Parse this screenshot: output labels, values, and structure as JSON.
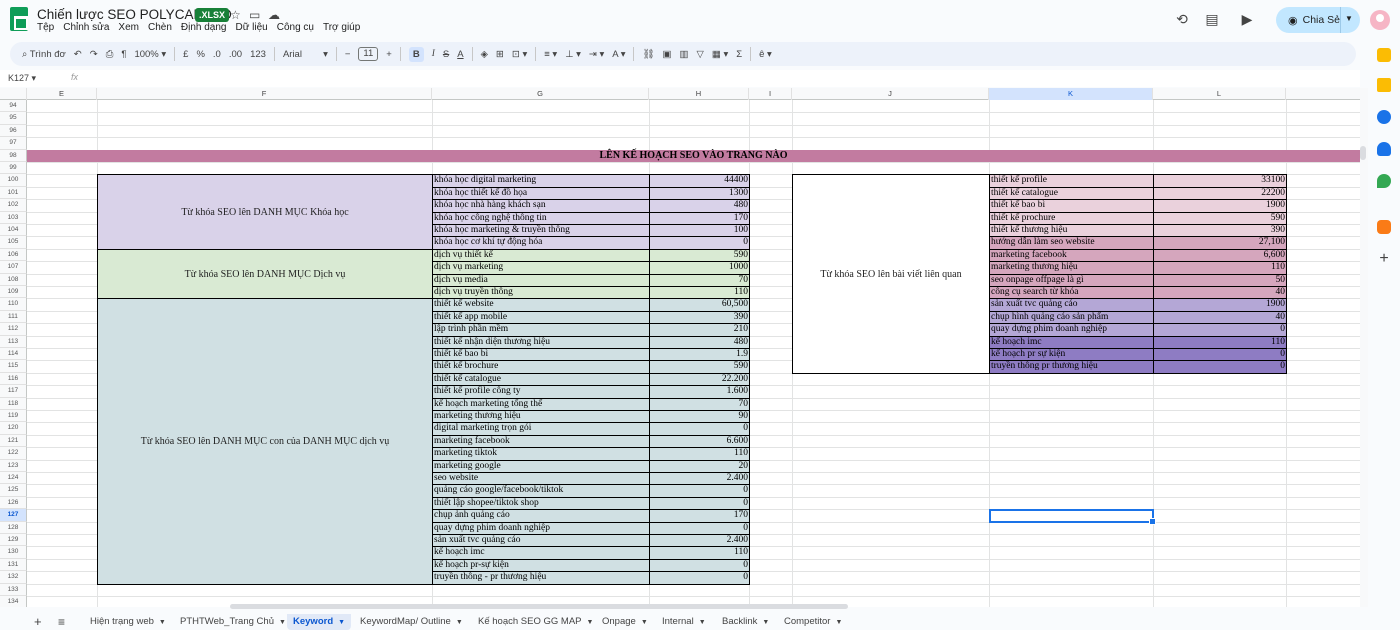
{
  "app": {
    "doc_title": "Chiến lược SEO POLYCANTHO",
    "file_badge": ".XLSX",
    "menus": [
      "Tệp",
      "Chỉnh sửa",
      "Xem",
      "Chèn",
      "Định dạng",
      "Dữ liệu",
      "Công cụ",
      "Trợ giúp"
    ],
    "share_label": "Chia Sẻ"
  },
  "toolbar": {
    "search_label": "Trình đơ",
    "zoom": "100%",
    "currency": "£",
    "percent": "%",
    "dec_less": ".0",
    "dec_more": ".00",
    "numfmt": "123",
    "font": "Arial",
    "font_size": "11"
  },
  "formula_bar": {
    "name_box": "K127",
    "fx": "fx"
  },
  "columns": [
    "E",
    "F",
    "G",
    "H",
    "I",
    "J",
    "K",
    "L"
  ],
  "selected_column": "K",
  "selected_row": "127",
  "rows": [
    "94",
    "95",
    "96",
    "97",
    "98",
    "99",
    "100",
    "101",
    "102",
    "103",
    "104",
    "105",
    "106",
    "107",
    "108",
    "109",
    "110",
    "111",
    "112",
    "113",
    "114",
    "115",
    "116",
    "117",
    "118",
    "119",
    "120",
    "121",
    "122",
    "123",
    "124",
    "125",
    "126",
    "127",
    "128",
    "129",
    "130",
    "131",
    "132",
    "133",
    "134"
  ],
  "sheet_title": "LÊN KẾ HOẠCH SEO VÀO TRANG NÀO",
  "left_groups": [
    {
      "label": "Từ khóa SEO lên DANH MỤC Khóa học",
      "color": "#d9d2e9",
      "items": [
        [
          "khóa học digital marketing",
          "44400"
        ],
        [
          "khóa học thiết kế đồ họa",
          "1300"
        ],
        [
          "khóa học nhà hàng khách sạn",
          "480"
        ],
        [
          "khóa học công nghệ thông tin",
          "170"
        ],
        [
          "khóa học marketing & truyền thông",
          "100"
        ],
        [
          "khóa học cơ khí tự động hóa",
          "0"
        ]
      ]
    },
    {
      "label": "Từ khóa SEO lên DANH MỤC Dịch vụ",
      "color": "#d9ead3",
      "items": [
        [
          "dịch vụ thiết kế",
          "590"
        ],
        [
          "dịch vụ marketing",
          "1000"
        ],
        [
          "dịch vụ media",
          "70"
        ],
        [
          "dịch vụ truyền thông",
          "110"
        ]
      ]
    },
    {
      "label": "Từ khóa SEO lên DANH MỤC con của DANH MỤC dịch vụ",
      "color": "#d0e0e3",
      "items": [
        [
          "thiết kế website",
          "60,500"
        ],
        [
          "thiết kế app mobile",
          "390"
        ],
        [
          "lập trình phần mềm",
          "210"
        ],
        [
          "thiết kế nhận diện thương hiệu",
          "480"
        ],
        [
          "thiết kế bao bì",
          "1.9"
        ],
        [
          "thiết kế brochure",
          "590"
        ],
        [
          "thiết kế catalogue",
          "22.200"
        ],
        [
          "thiết kế profile công ty",
          "1.600"
        ],
        [
          "kế hoạch marketing tổng thể",
          "70"
        ],
        [
          "marketing thương hiệu",
          "90"
        ],
        [
          "digital marketing trọn gói",
          "0"
        ],
        [
          "marketing facebook",
          "6.600"
        ],
        [
          "marketing tiktok",
          "110"
        ],
        [
          "marketing google",
          "20"
        ],
        [
          "seo website",
          "2.400"
        ],
        [
          "quảng cáo google/facebook/tiktok",
          "0"
        ],
        [
          "thiết lập shopee/tiktok shop",
          "0"
        ],
        [
          "chụp ảnh quảng cáo",
          "170"
        ],
        [
          "quay dựng phim doanh nghiệp",
          "0"
        ],
        [
          "sản xuất tvc quảng cáo",
          "2.400"
        ],
        [
          "kế hoạch imc",
          "110"
        ],
        [
          "kế hoạch pr-sự kiện",
          "0"
        ],
        [
          "truyền thông - pr thương hiệu",
          "0"
        ]
      ]
    }
  ],
  "right_group": {
    "label": "Từ khóa SEO lên bài viết liên quan",
    "items": [
      [
        "thiết kế profile",
        "33100",
        "#ead1dc"
      ],
      [
        "thiết kế catalogue",
        "22200",
        "#ead1dc"
      ],
      [
        "thiết kế bao bì",
        "1900",
        "#ead1dc"
      ],
      [
        "thiết kế prochure",
        "590",
        "#ead1dc"
      ],
      [
        "thiết kế thương hiệu",
        "390",
        "#ead1dc"
      ],
      [
        "hướng dẫn làm seo website",
        "27,100",
        "#d5a6bd"
      ],
      [
        "marketing facebook",
        "6,600",
        "#d5a6bd"
      ],
      [
        "marketing thương hiệu",
        "110",
        "#d5a6bd"
      ],
      [
        "seo onpage offpage là gì",
        "50",
        "#d5a6bd"
      ],
      [
        "công cụ search từ khóa",
        "40",
        "#d5a6bd"
      ],
      [
        "sản xuất tvc quảng cáo",
        "1900",
        "#b4a7d6"
      ],
      [
        "chụp hình quảng cáo sản phẩm",
        "40",
        "#b4a7d6"
      ],
      [
        "quay dựng phim doanh nghiệp",
        "0",
        "#b4a7d6"
      ],
      [
        "kế hoạch imc",
        "110",
        "#8e7cc3"
      ],
      [
        "kế hoạch pr sự kiện",
        "0",
        "#8e7cc3"
      ],
      [
        "truyền thông pr thương hiệu",
        "0",
        "#8e7cc3"
      ]
    ]
  },
  "sheet_tabs": [
    "Hiện trạng web",
    "PTHTWeb_Trang Chủ",
    "Keyword",
    "KeywordMap/ Outline",
    "Kế hoạch SEO GG MAP",
    "Onpage",
    "Internal",
    "Backlink",
    "Competitor"
  ],
  "active_tab": "Keyword",
  "colors": {
    "title_row": "#c27ba0",
    "accent": "#1a73e8",
    "share": "#c2e7ff"
  }
}
